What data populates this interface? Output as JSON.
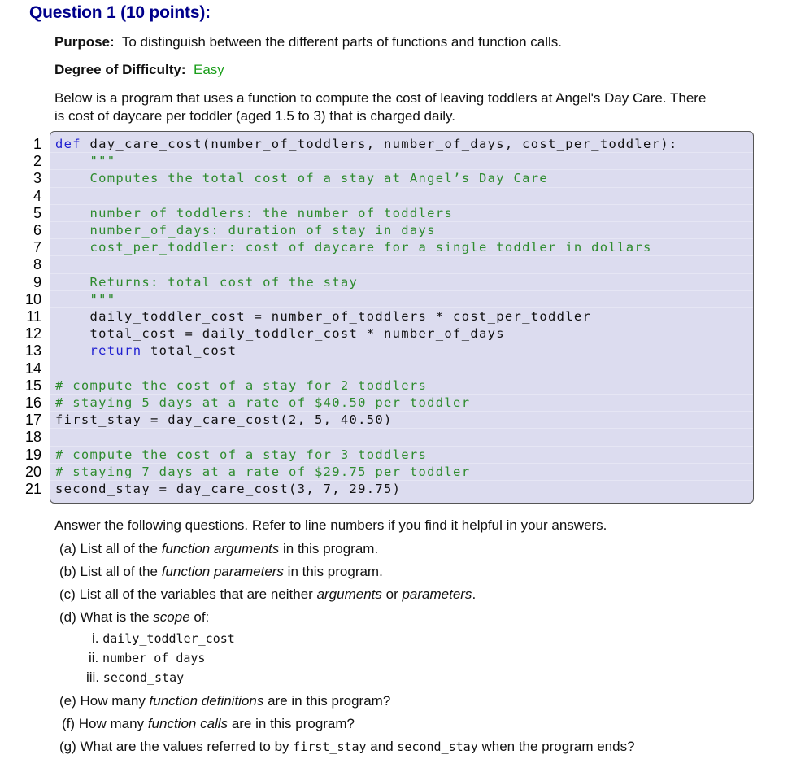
{
  "question": {
    "title": "Question 1 (10 points):",
    "purpose_label": "Purpose:",
    "purpose_text": "To distinguish between the different parts of functions and function calls.",
    "difficulty_label": "Degree of Difficulty:",
    "difficulty_value": "Easy",
    "intro_line1": "Below is a program that uses a function to compute the cost of leaving toddlers at Angel's Day Care. There",
    "intro_line2": "is cost of daycare per toddler (aged 1.5 to 3) that is charged daily."
  },
  "code": {
    "lines": [
      {
        "n": "1",
        "parts": [
          {
            "t": "def",
            "c": "kw"
          },
          {
            "t": " day_care_cost(number_of_toddlers, number_of_days, cost_per_toddler):",
            "c": ""
          }
        ]
      },
      {
        "n": "2",
        "parts": [
          {
            "t": "    \"\"\"",
            "c": "str"
          }
        ]
      },
      {
        "n": "3",
        "parts": [
          {
            "t": "    Computes the total cost of a stay at Angel’s Day Care",
            "c": "str"
          }
        ]
      },
      {
        "n": "4",
        "parts": []
      },
      {
        "n": "5",
        "parts": [
          {
            "t": "    number_of_toddlers: the number of toddlers",
            "c": "str"
          }
        ]
      },
      {
        "n": "6",
        "parts": [
          {
            "t": "    number_of_days: duration of stay in days",
            "c": "str"
          }
        ]
      },
      {
        "n": "7",
        "parts": [
          {
            "t": "    cost_per_toddler: cost of daycare for a single toddler in dollars",
            "c": "str"
          }
        ]
      },
      {
        "n": "8",
        "parts": []
      },
      {
        "n": "9",
        "parts": [
          {
            "t": "    Returns: total cost of the stay",
            "c": "str"
          }
        ]
      },
      {
        "n": "10",
        "parts": [
          {
            "t": "    \"\"\"",
            "c": "str"
          }
        ]
      },
      {
        "n": "11",
        "parts": [
          {
            "t": "    daily_toddler_cost = number_of_toddlers * cost_per_toddler",
            "c": ""
          }
        ]
      },
      {
        "n": "12",
        "parts": [
          {
            "t": "    total_cost = daily_toddler_cost * number_of_days",
            "c": ""
          }
        ]
      },
      {
        "n": "13",
        "parts": [
          {
            "t": "    ",
            "c": ""
          },
          {
            "t": "return",
            "c": "kw"
          },
          {
            "t": " total_cost",
            "c": ""
          }
        ]
      },
      {
        "n": "14",
        "parts": []
      },
      {
        "n": "15",
        "parts": [
          {
            "t": "# compute the cost of a stay for 2 toddlers",
            "c": "cm"
          }
        ]
      },
      {
        "n": "16",
        "parts": [
          {
            "t": "# staying 5 days at a rate of $40.50 per toddler",
            "c": "cm"
          }
        ]
      },
      {
        "n": "17",
        "parts": [
          {
            "t": "first_stay = day_care_cost(2, 5, 40.50)",
            "c": ""
          }
        ]
      },
      {
        "n": "18",
        "parts": []
      },
      {
        "n": "19",
        "parts": [
          {
            "t": "# compute the cost of a stay for 3 toddlers",
            "c": "cm"
          }
        ]
      },
      {
        "n": "20",
        "parts": [
          {
            "t": "# staying 7 days at a rate of $29.75 per toddler",
            "c": "cm"
          }
        ]
      },
      {
        "n": "21",
        "parts": [
          {
            "t": "second_stay = day_care_cost(3, 7, 29.75)",
            "c": ""
          }
        ]
      }
    ]
  },
  "questions": {
    "instructions": "Answer the following questions. Refer to line numbers if you find it helpful in your answers.",
    "a": {
      "label": "(a)",
      "pre": "List all of the ",
      "em": "function arguments",
      "post": " in this program."
    },
    "b": {
      "label": "(b)",
      "pre": "List all of the ",
      "em": "function parameters",
      "post": " in this program."
    },
    "c": {
      "label": "(c)",
      "pre": "List all of the variables that are neither ",
      "em": "arguments",
      "mid": " or ",
      "em2": "parameters",
      "post": "."
    },
    "d": {
      "label": "(d)",
      "pre": "What is the ",
      "em": "scope",
      "post": " of:",
      "sub": [
        {
          "label": "i.",
          "code": "daily_toddler_cost"
        },
        {
          "label": "ii.",
          "code": "number_of_days"
        },
        {
          "label": "iii.",
          "code": "second_stay"
        }
      ]
    },
    "e": {
      "label": "(e)",
      "pre": "How many ",
      "em": "function definitions",
      "post": " are in this program?"
    },
    "f": {
      "label": "(f)",
      "pre": "How many ",
      "em": "function calls",
      "post": " are in this program?"
    },
    "g": {
      "label": "(g)",
      "pre": "What are the values referred to by ",
      "code1": "first_stay",
      "mid": " and ",
      "code2": "second_stay",
      "post": " when the program ends?"
    }
  }
}
